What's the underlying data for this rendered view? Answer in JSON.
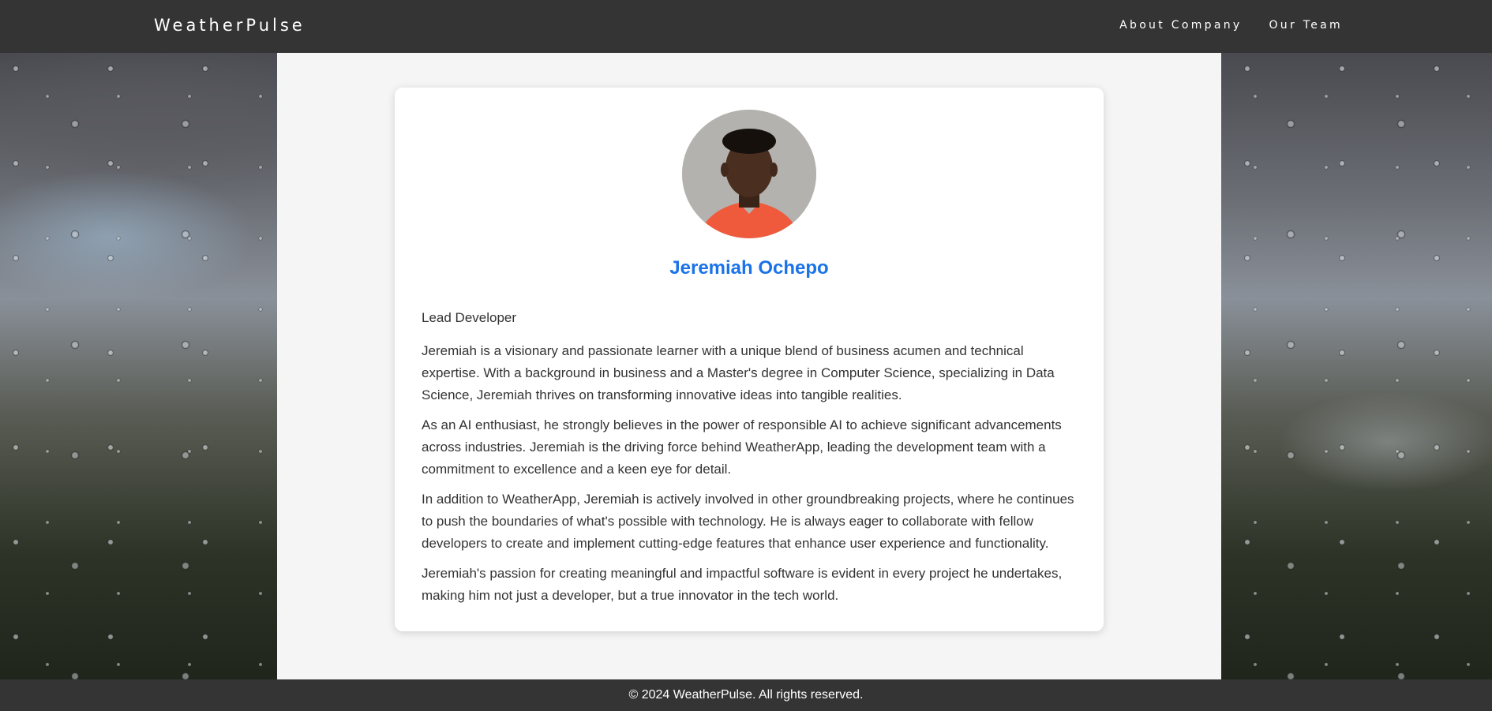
{
  "brand": "WeatherPulse",
  "nav": {
    "items": [
      {
        "label": "About Company"
      },
      {
        "label": "Our Team"
      }
    ]
  },
  "profile": {
    "name": "Jeremiah Ochepo",
    "role": "Lead Developer",
    "bio": [
      "Jeremiah is a visionary and passionate learner with a unique blend of business acumen and technical expertise. With a background in business and a Master's degree in Computer Science, specializing in Data Science, Jeremiah thrives on transforming innovative ideas into tangible realities.",
      "As an AI enthusiast, he strongly believes in the power of responsible AI to achieve significant advancements across industries. Jeremiah is the driving force behind WeatherApp, leading the development team with a commitment to excellence and a keen eye for detail.",
      "In addition to WeatherApp, Jeremiah is actively involved in other groundbreaking projects, where he continues to push the boundaries of what's possible with technology. He is always eager to collaborate with fellow developers to create and implement cutting-edge features that enhance user experience and functionality.",
      "Jeremiah's passion for creating meaningful and impactful software is evident in every project he undertakes, making him not just a developer, but a true innovator in the tech world."
    ]
  },
  "footer": {
    "text": "© 2024 WeatherPulse. All rights reserved."
  },
  "colors": {
    "navbar": "#343434",
    "accent": "#1a73e8",
    "main_bg": "#f5f5f5"
  }
}
